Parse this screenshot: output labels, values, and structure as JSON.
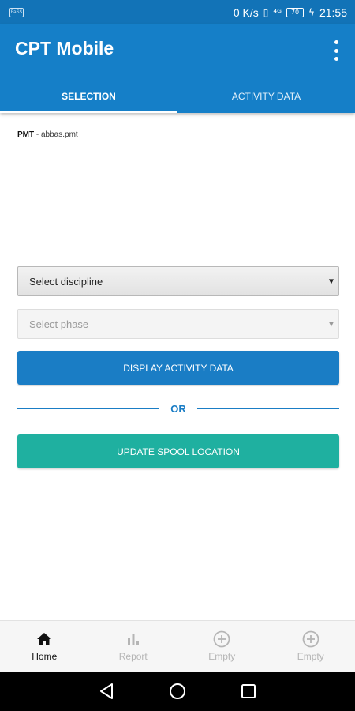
{
  "status_bar": {
    "app_icon_text": "PaSS",
    "network_speed": "0 K/s",
    "vibrate_glyph": "▯",
    "signal_glyph": "⁴ᴳ",
    "battery_level": "70",
    "charging_glyph": "ϟ",
    "time": "21:55"
  },
  "app_bar": {
    "title": "CPT Mobile",
    "menu_icon": "more-vert-icon",
    "background_color": "#157fc8"
  },
  "tabs": [
    {
      "label": "SELECTION",
      "active": true
    },
    {
      "label": "ACTIVITY DATA",
      "active": false
    }
  ],
  "selection": {
    "pmt_label": "PMT",
    "pmt_value": " - abbas.pmt",
    "discipline_select": {
      "value": "Select discipline",
      "caret": "▼"
    },
    "phase_select": {
      "value": "Select phase",
      "caret": "▼",
      "disabled": true
    },
    "display_button_label": "DISPLAY ACTIVITY DATA",
    "or_text": "OR",
    "spool_button_label": "UPDATE SPOOL LOCATION"
  },
  "colors": {
    "primary": "#1a7dc5",
    "teal": "#1fb0a0",
    "status_bar": "#1273b7"
  },
  "bottom_nav": [
    {
      "label": "Home",
      "icon": "home-icon",
      "active": true
    },
    {
      "label": "Report",
      "icon": "bar-chart-icon",
      "active": false
    },
    {
      "label": "Empty",
      "icon": "add-circle-icon",
      "active": false
    },
    {
      "label": "Empty",
      "icon": "add-circle-icon",
      "active": false
    }
  ]
}
